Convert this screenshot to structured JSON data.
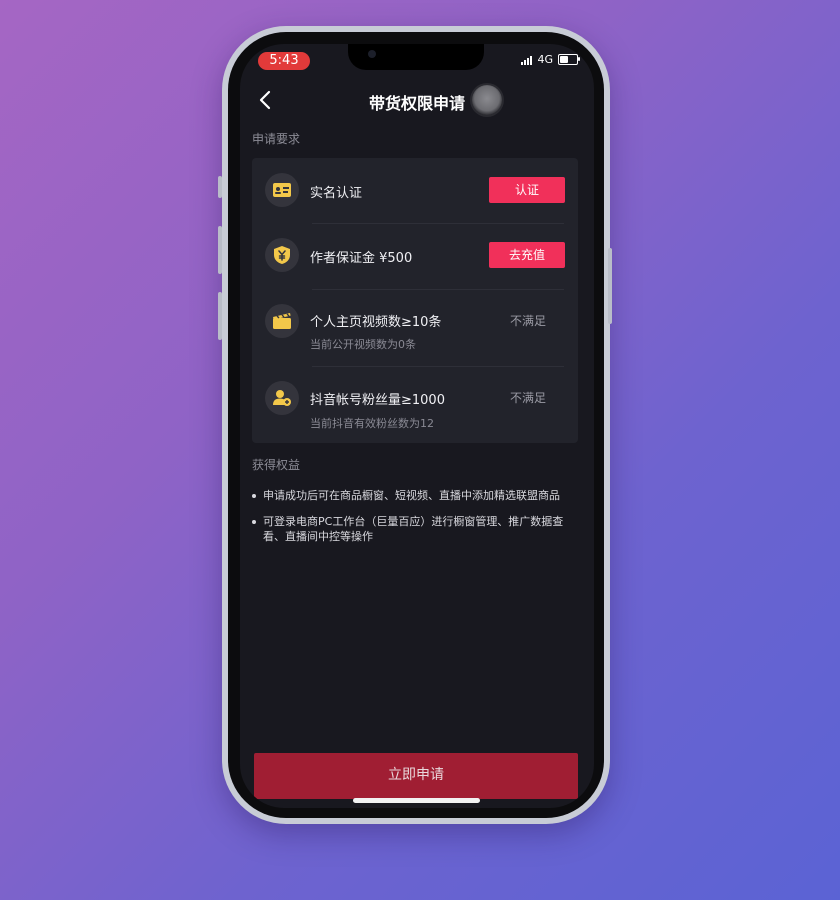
{
  "status_bar": {
    "time": "5:43",
    "network": "4G"
  },
  "header": {
    "title": "带货权限申请",
    "back_icon": "chevron-left-icon"
  },
  "requirements": {
    "label": "申请要求",
    "items": [
      {
        "icon": "id-card-icon",
        "title": "实名认证",
        "subtitle": "",
        "action": "认证",
        "status": ""
      },
      {
        "icon": "yuan-shield-icon",
        "title": "作者保证金 ¥500",
        "subtitle": "",
        "action": "去充值",
        "status": ""
      },
      {
        "icon": "clapperboard-icon",
        "title": "个人主页视频数≥10条",
        "subtitle": "当前公开视频数为0条",
        "action": "",
        "status": "不满足"
      },
      {
        "icon": "fans-icon",
        "title": "抖音帐号粉丝量≥1000",
        "subtitle": "当前抖音有效粉丝数为12",
        "action": "",
        "status": "不满足"
      }
    ]
  },
  "benefits": {
    "label": "获得权益",
    "items": [
      "申请成功后可在商品橱窗、短视频、直播中添加精选联盟商品",
      "可登录电商PC工作台（巨量百应）进行橱窗管理、推广数据查看、直播间中控等操作"
    ]
  },
  "apply_button": "立即申请",
  "colors": {
    "accent": "#f1305a",
    "apply": "#a01e33",
    "icon": "#f3c84a",
    "screen_bg": "#18181f",
    "card_bg": "#22232b"
  }
}
